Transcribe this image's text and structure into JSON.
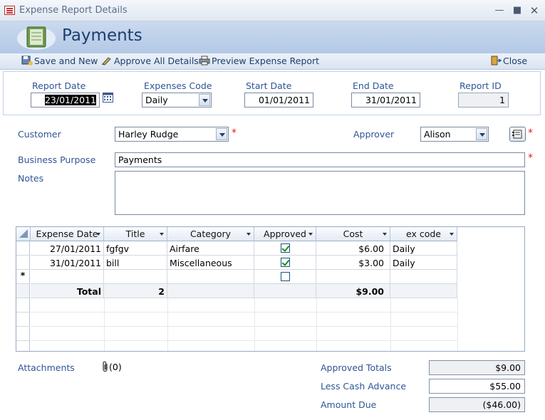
{
  "window": {
    "title": "Expense Report Details"
  },
  "header": {
    "title": "Payments"
  },
  "toolbar": {
    "save_new": "Save and New",
    "approve_all": "Approve All Details",
    "preview": "Preview Expense Report",
    "close": "Close"
  },
  "top": {
    "report_date_label": "Report Date",
    "report_date": "23/01/2011",
    "expenses_code_label": "Expenses Code",
    "expenses_code": "Daily",
    "start_date_label": "Start Date",
    "start_date": "01/01/2011",
    "end_date_label": "End Date",
    "end_date": "31/01/2011",
    "report_id_label": "Report ID",
    "report_id": "1"
  },
  "form": {
    "customer_label": "Customer",
    "customer": "Harley Rudge",
    "approver_label": "Approver",
    "approver": "Alison",
    "purpose_label": "Business Purpose",
    "purpose": "Payments",
    "notes_label": "Notes",
    "notes": "",
    "required_marker": "*"
  },
  "grid": {
    "columns": [
      "Expense Date",
      "Title",
      "Category",
      "Approved",
      "Cost",
      "ex code"
    ],
    "rows": [
      {
        "date": "27/01/2011",
        "title": "fgfgv",
        "category": "Airfare",
        "approved": true,
        "cost": "$6.00",
        "code": "Daily"
      },
      {
        "date": "31/01/2011",
        "title": "bill",
        "category": "Miscellaneous",
        "approved": true,
        "cost": "$3.00",
        "code": "Daily"
      }
    ],
    "new_row_marker": "*",
    "total_label": "Total",
    "total_count": "2",
    "total_cost": "$9.00"
  },
  "footer": {
    "attachments_label": "Attachments",
    "attachments_count": "(0)",
    "approved_totals_label": "Approved Totals",
    "approved_totals": "$9.00",
    "cash_advance_label": "Less Cash Advance",
    "cash_advance": "$55.00",
    "amount_due_label": "Amount Due",
    "amount_due": "($46.00)"
  },
  "icons": [
    "form-icon",
    "minimize-icon",
    "maximize-icon",
    "close-window-icon",
    "notebook-logo-icon",
    "save-icon",
    "approve-icon",
    "printer-icon",
    "door-close-icon",
    "calendar-icon",
    "address-book-icon",
    "paperclip-icon"
  ]
}
